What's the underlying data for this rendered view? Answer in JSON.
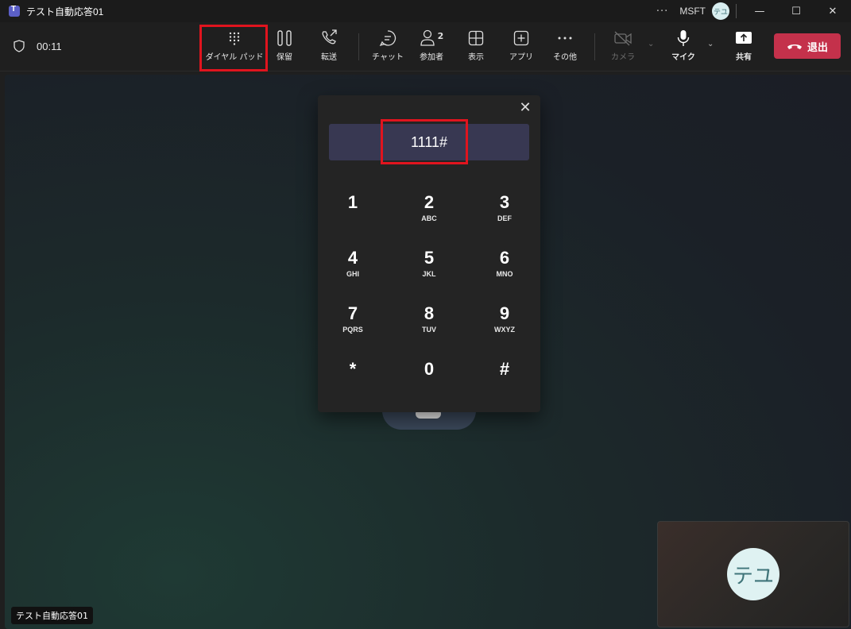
{
  "window": {
    "title": "テスト自動応答01",
    "more_label": "···",
    "org": "MSFT",
    "user_initials": "テユ",
    "minimize": "—",
    "maximize": "☐",
    "close": "✕"
  },
  "toolbar": {
    "timer": "00:11",
    "dialpad_label": "ダイヤル パッド",
    "hold_label": "保留",
    "transfer_label": "転送",
    "chat_label": "チャット",
    "participants_label": "参加者",
    "participants_count": "2",
    "view_label": "表示",
    "apps_label": "アプリ",
    "more_label": "その他",
    "camera_label": "カメラ",
    "mic_label": "マイク",
    "share_label": "共有",
    "leave_label": "退出"
  },
  "stage": {
    "caller_name": "テスト自動応答01"
  },
  "selfview": {
    "initials": "テユ"
  },
  "dialpad": {
    "entered": "1111#",
    "close_glyph": "✕",
    "keys": [
      {
        "num": "1",
        "letters": ""
      },
      {
        "num": "2",
        "letters": "ABC"
      },
      {
        "num": "3",
        "letters": "DEF"
      },
      {
        "num": "4",
        "letters": "GHI"
      },
      {
        "num": "5",
        "letters": "JKL"
      },
      {
        "num": "6",
        "letters": "MNO"
      },
      {
        "num": "7",
        "letters": "PQRS"
      },
      {
        "num": "8",
        "letters": "TUV"
      },
      {
        "num": "9",
        "letters": "WXYZ"
      },
      {
        "num": "*",
        "letters": ""
      },
      {
        "num": "0",
        "letters": ""
      },
      {
        "num": "#",
        "letters": ""
      }
    ]
  },
  "colors": {
    "leave": "#c4314b",
    "highlight": "#e0141e",
    "brand": "#5b5fc7"
  }
}
